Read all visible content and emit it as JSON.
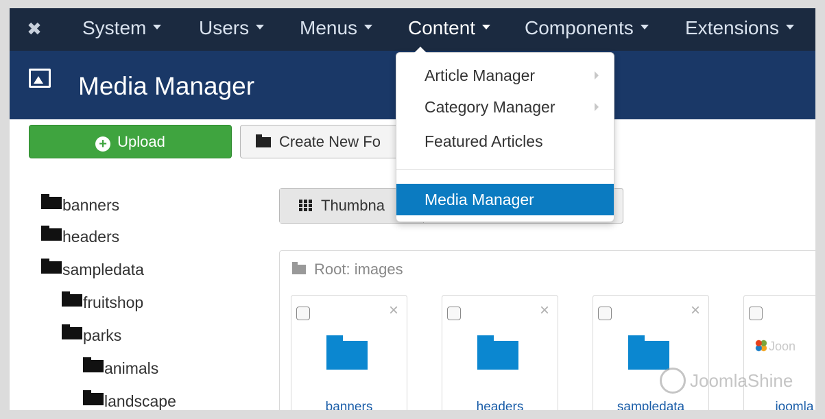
{
  "topnav": {
    "logo_icon": "joomla-logo-icon",
    "items": [
      {
        "label": "System"
      },
      {
        "label": "Users"
      },
      {
        "label": "Menus"
      },
      {
        "label": "Content"
      },
      {
        "label": "Components"
      },
      {
        "label": "Extensions"
      }
    ],
    "active_item": "Content"
  },
  "header": {
    "icon": "image-icon",
    "title": "Media Manager"
  },
  "toolbar": {
    "upload_label": "Upload",
    "create_folder_label": "Create New Fo"
  },
  "tree": {
    "items": [
      {
        "label": "banners"
      },
      {
        "label": "headers"
      },
      {
        "label": "sampledata"
      },
      {
        "label": "fruitshop"
      },
      {
        "label": "parks"
      },
      {
        "label": "animals"
      },
      {
        "label": "landscape"
      }
    ]
  },
  "view_switch": {
    "thumbnail_label": "Thumbna"
  },
  "root_panel": {
    "path": "Root: images",
    "items": [
      {
        "label": "banners"
      },
      {
        "label": "headers"
      },
      {
        "label": "sampledata"
      },
      {
        "label": "joomla_b",
        "logo_text": "Joon"
      }
    ]
  },
  "dropdown": {
    "items": [
      {
        "label": "Article Manager",
        "has_submenu": true
      },
      {
        "label": "Category Manager",
        "has_submenu": true
      },
      {
        "label": "Featured Articles",
        "has_submenu": false
      },
      {
        "label": "Media Manager",
        "has_submenu": false,
        "active": true
      }
    ]
  },
  "watermark": {
    "text": "JoomlaShine"
  },
  "colors": {
    "topnav_bg": "#1b2a40",
    "header_bg": "#1a3867",
    "upload_green": "#3fa43f",
    "active_blue": "#0b7bc1",
    "folder_blue": "#0b87d0"
  }
}
